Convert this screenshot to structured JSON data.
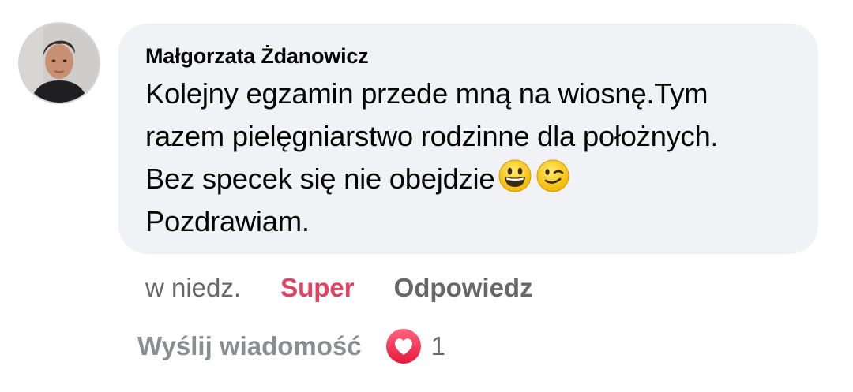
{
  "comment": {
    "author": "Małgorzata Żdanowicz",
    "lines": [
      "Kolejny egzamin przede mną na wiosnę.Tym",
      "razem pielęgniarstwo rodzinne dla położnych.",
      "Bez specek się nie obejdzie",
      "Pozdrawiam."
    ],
    "emojis": [
      "grinning-face-emoji",
      "winking-face-emoji"
    ]
  },
  "actions": {
    "time": "w niedz.",
    "super_label": "Super",
    "reply_label": "Odpowiedz"
  },
  "footer": {
    "send_message_label": "Wyślij wiadomość",
    "reaction_icon": "heart-icon",
    "reaction_count": "1"
  },
  "colors": {
    "bubble_bg": "#f0f2f5",
    "super": "#e4405f",
    "muted": "#65676b",
    "heart": "#f33e58"
  }
}
